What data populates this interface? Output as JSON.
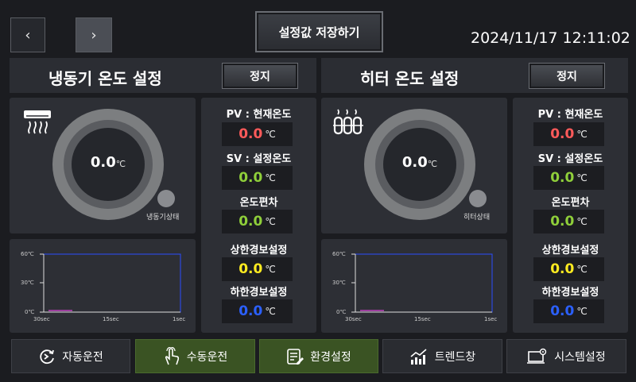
{
  "topbar": {
    "back_icon": "‹",
    "forward_icon": "›",
    "save_label": "설정값 저장하기",
    "datetime": "2024/11/17 12:11:02"
  },
  "left": {
    "title": "냉동기 온도 설정",
    "stop_label": "정지",
    "icon": "air-conditioner-icon",
    "gauge_value": "0.0",
    "gauge_unit": "℃",
    "status_label": "냉동기상태",
    "pv_label": "PV : 현재온도",
    "pv_value": "0.0",
    "sv_label": "SV : 설정온도",
    "sv_value": "0.0",
    "dev_label": "온도편차",
    "dev_value": "0.0",
    "high_label": "상한경보설정",
    "high_value": "0.0",
    "low_label": "하한경보설정",
    "low_value": "0.0",
    "unit": "℃",
    "chart_y_ticks": [
      "60℃",
      "30℃",
      "0℃"
    ],
    "chart_x_ticks": [
      "30sec",
      "15sec",
      "1sec"
    ]
  },
  "right": {
    "title": "히터 온도 설정",
    "stop_label": "정지",
    "icon": "heater-icon",
    "gauge_value": "0.0",
    "gauge_unit": "℃",
    "status_label": "히터상태",
    "pv_label": "PV : 현재온도",
    "pv_value": "0.0",
    "sv_label": "SV : 설정온도",
    "sv_value": "0.0",
    "dev_label": "온도편차",
    "dev_value": "0.0",
    "high_label": "상한경보설정",
    "high_value": "0.0",
    "low_label": "하한경보설정",
    "low_value": "0.0",
    "unit": "℃",
    "chart_y_ticks": [
      "60℃",
      "30℃",
      "0℃"
    ],
    "chart_x_ticks": [
      "30sec",
      "15sec",
      "1sec"
    ]
  },
  "bottom_nav": [
    {
      "label": "자동운전",
      "icon": "auto-run-icon",
      "selected": false
    },
    {
      "label": "수동운전",
      "icon": "hand-touch-icon",
      "selected": true
    },
    {
      "label": "환경설정",
      "icon": "settings-list-icon",
      "selected": true
    },
    {
      "label": "트렌드창",
      "icon": "trend-chart-icon",
      "selected": false
    },
    {
      "label": "시스템설정",
      "icon": "system-settings-icon",
      "selected": false
    }
  ],
  "colors": {
    "pv": "#ff5a5a",
    "sv": "#8fcf3a",
    "deviation": "#8fcf3a",
    "high_alarm": "#ffeb20",
    "low_alarm": "#2b60ff",
    "selected_nav": "#3a5323",
    "chart_line": "#2b4dff"
  }
}
